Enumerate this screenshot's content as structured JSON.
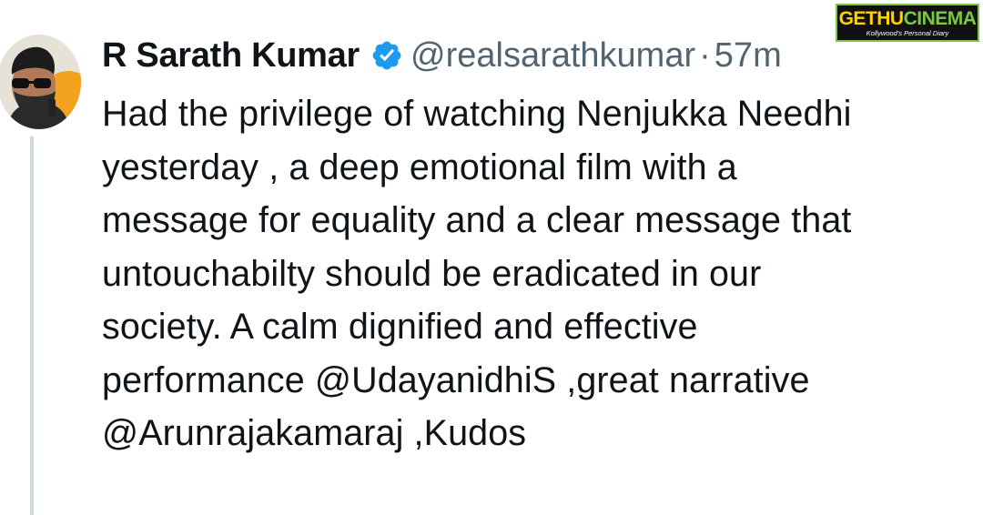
{
  "tweet": {
    "display_name": "R Sarath Kumar",
    "handle": "@realsarathkumar",
    "separator": "·",
    "time": "57m",
    "verified": true,
    "text": "Had the privilege of watching Nenjukka Needhi\nyesterday , a deep emotional film with a\nmessage for equality and a clear message that\nuntouchabilty should be eradicated in our\nsociety. A calm dignified and effective\nperformance @UdayanidhiS ,great narrative\n@Arunrajakamaraj ,Kudos"
  },
  "watermark": {
    "brand_part1": "GETHU",
    "brand_part2": "CINEMA",
    "tagline": "Kollywood's Personal Diary"
  },
  "colors": {
    "text": "#0f1419",
    "secondary": "#536471",
    "verified_blue": "#1d9bf0",
    "thread_line": "#cfd9de",
    "watermark_green": "#7ac943",
    "watermark_yellow": "#ffd200"
  },
  "icons": {
    "verified": "verified-badge-icon"
  }
}
